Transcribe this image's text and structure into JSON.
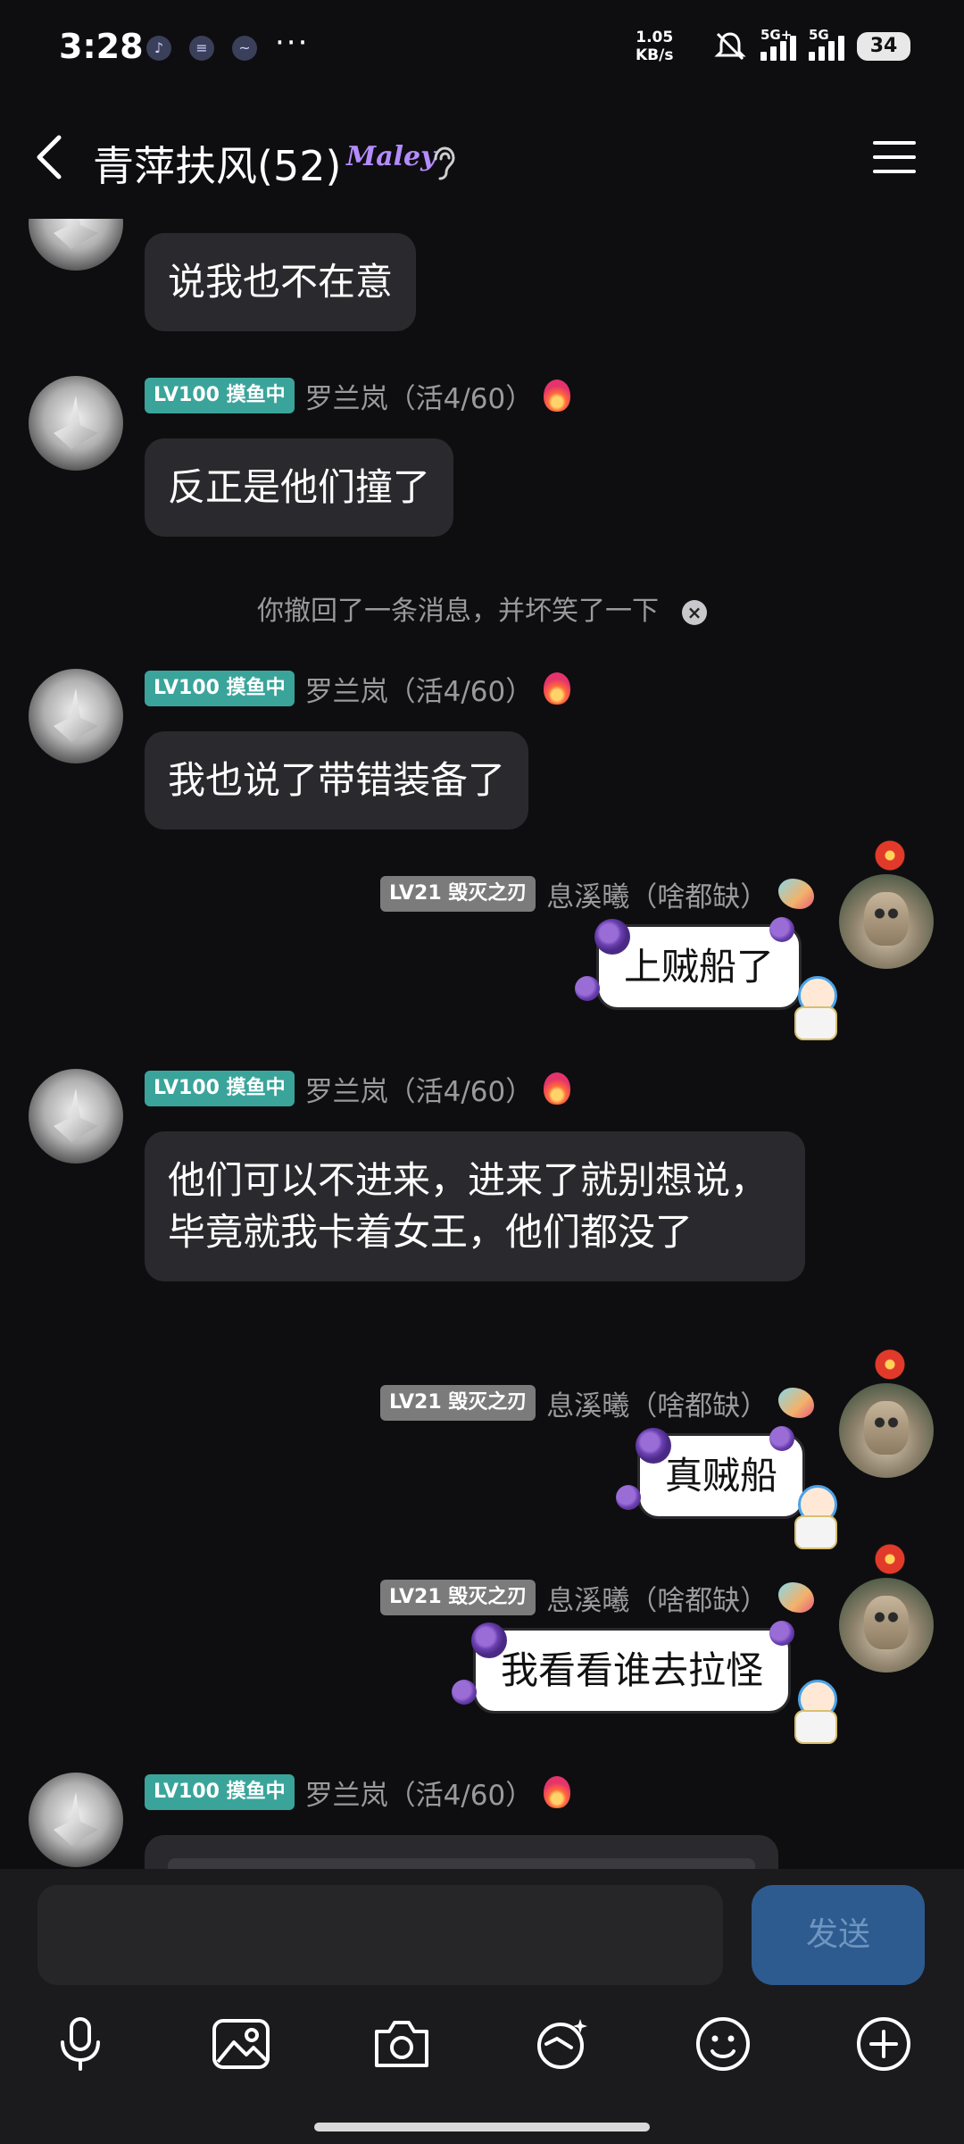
{
  "status_bar": {
    "time": "3:28",
    "net_speed": "1.05",
    "net_speed_unit": "KB/s",
    "sim1": "5G+",
    "sim2": "5G",
    "battery": "34",
    "more": "···"
  },
  "header": {
    "title": "青萍扶风(52)",
    "badge": "Maley"
  },
  "messages": {
    "m1": {
      "text": "说我也不在意"
    },
    "m2": {
      "level": "LV100 摸鱼中",
      "sender": "罗兰岚（活4/60）",
      "text": "反正是他们撞了"
    },
    "system": {
      "text": "你撤回了一条消息，并坏笑了一下"
    },
    "m3": {
      "level": "LV100 摸鱼中",
      "sender": "罗兰岚（活4/60）",
      "text": "我也说了带错装备了"
    },
    "m4": {
      "level": "LV21 毁灭之刃",
      "sender": "息溪曦（啥都缺）",
      "text": "上贼船了"
    },
    "m5": {
      "level": "LV100 摸鱼中",
      "sender": "罗兰岚（活4/60）",
      "text": "他们可以不进来，进来了就别想说，毕竟就我卡着女王，他们都没了"
    },
    "m6": {
      "level": "LV21 毁灭之刃",
      "sender": "息溪曦（啥都缺）",
      "text": "真贼船"
    },
    "m7": {
      "level": "LV21 毁灭之刃",
      "sender": "息溪曦（啥都缺）",
      "text": "我看看谁去拉怪"
    },
    "m8": {
      "level": "LV100 摸鱼中",
      "sender": "罗兰岚（活4/60）"
    }
  },
  "composer": {
    "placeholder": "",
    "send_label": "发送"
  },
  "colors": {
    "background": "#0e0e10",
    "bubble": "#2a2a2e",
    "level_teal": "#3aa49a",
    "level_gray": "#7b7b7b",
    "send_button": "#2d5b8f"
  },
  "icons": [
    "back-icon",
    "menu-icon",
    "ear-icon",
    "mic-icon",
    "image-icon",
    "camera-icon",
    "magic-icon",
    "emoji-icon",
    "plus-icon"
  ]
}
